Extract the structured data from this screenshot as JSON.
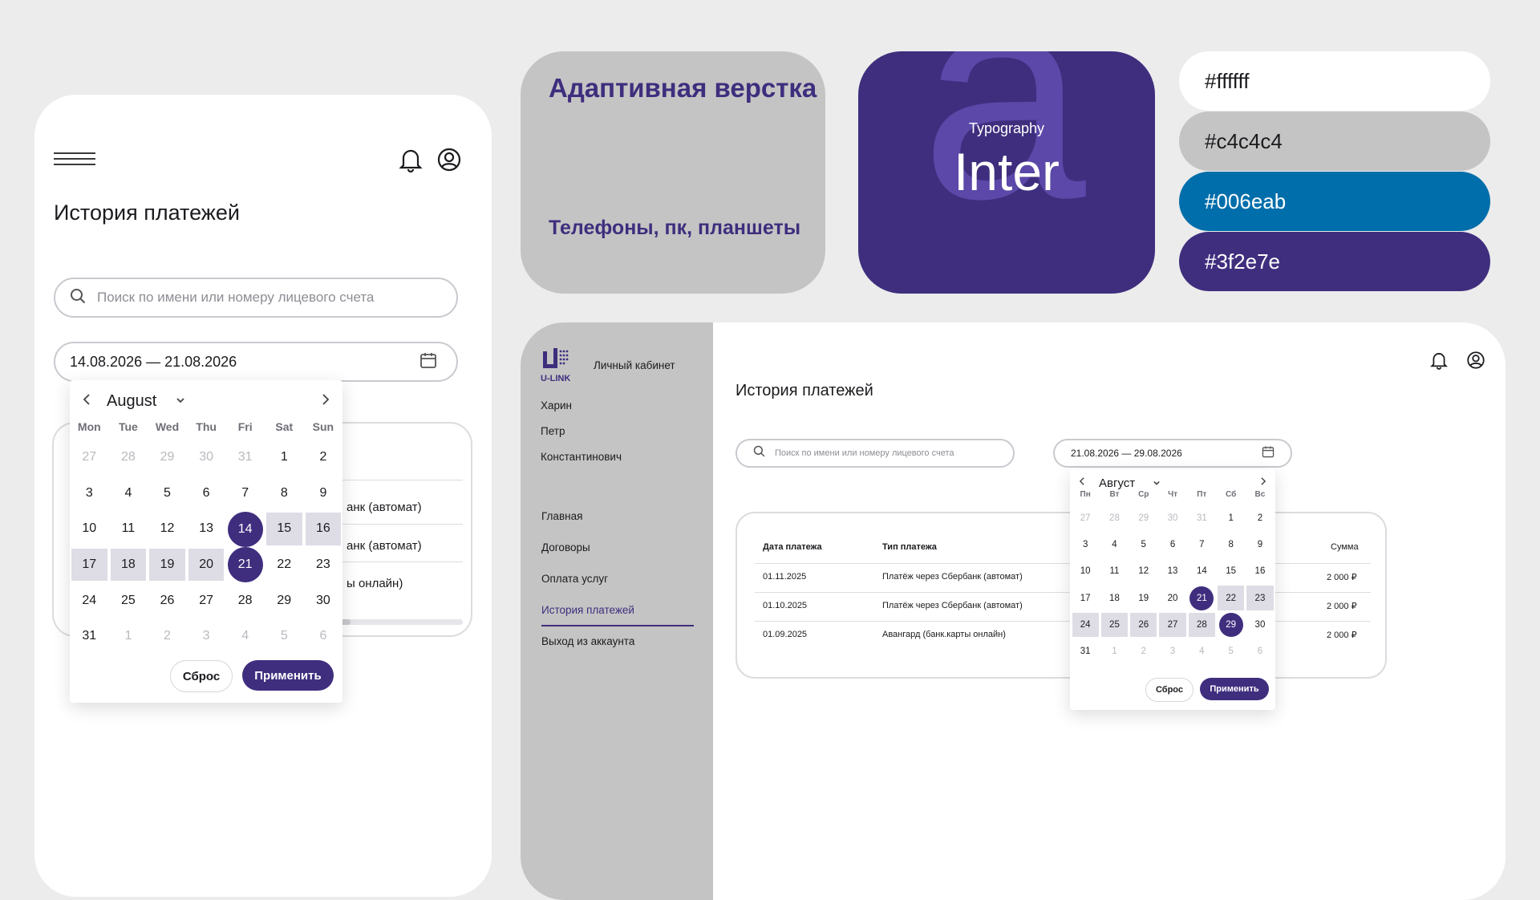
{
  "colors": {
    "background": "#ececec",
    "white": "#ffffff",
    "gray": "#c4c4c4",
    "blue": "#006eab",
    "purple": "#3f2e7e"
  },
  "mobile": {
    "title": "История платежей",
    "search_placeholder": "Поиск по имени или номеру лицевого счета",
    "date_range": "14.08.2026 — 21.08.2026",
    "row_fragments": [
      "анк (автомат)",
      "анк (автомат)",
      "ы онлайн)"
    ],
    "calendar": {
      "month": "August",
      "weekdays": [
        "Mon",
        "Tue",
        "Wed",
        "Thu",
        "Fri",
        "Sat",
        "Sun"
      ],
      "days": [
        [
          "27",
          "28",
          "29",
          "30",
          "31",
          "1",
          "2"
        ],
        [
          "3",
          "4",
          "5",
          "6",
          "7",
          "8",
          "9"
        ],
        [
          "10",
          "11",
          "12",
          "13",
          "14",
          "15",
          "16"
        ],
        [
          "17",
          "18",
          "19",
          "20",
          "21",
          "22",
          "23"
        ],
        [
          "24",
          "25",
          "26",
          "27",
          "28",
          "29",
          "30"
        ],
        [
          "31",
          "1",
          "2",
          "3",
          "4",
          "5",
          "6"
        ]
      ],
      "range_start": "14",
      "range_end": "21",
      "reset_label": "Сброс",
      "apply_label": "Применить"
    }
  },
  "adaptive_card": {
    "title": "Адаптивная верстка",
    "subtitle": "Телефоны, пк, планшеты"
  },
  "typography_card": {
    "label": "Typography",
    "font_name": "Inter",
    "glyph": "a"
  },
  "palette": [
    {
      "hex": "#ffffff",
      "text_color": "#1b1b1f"
    },
    {
      "hex": "#c4c4c4",
      "text_color": "#1b1b1f"
    },
    {
      "hex": "#006eab",
      "text_color": "#ffffff"
    },
    {
      "hex": "#3f2e7e",
      "text_color": "#ffffff"
    }
  ],
  "desktop": {
    "logo_text": "U-LINK",
    "cabinet_label": "Личный кабинет",
    "user_name": [
      "Харин",
      "Петр",
      "Константинович"
    ],
    "nav": [
      "Главная",
      "Договоры",
      "Оплата услуг",
      "История платежей",
      "Выход из аккаунта"
    ],
    "active_nav": "История платежей",
    "title": "История платежей",
    "search_placeholder": "Поиск по имени или номеру лицевого счета",
    "date_range": "21.08.2026 — 29.08.2026",
    "table": {
      "headers": [
        "Дата платежа",
        "Тип платежа",
        "Сумма"
      ],
      "rows": [
        [
          "01.11.2025",
          "Платёж через Сбербанк (автомат)",
          "2 000 ₽"
        ],
        [
          "01.10.2025",
          "Платёж через Сбербанк (автомат)",
          "2 000 ₽"
        ],
        [
          "01.09.2025",
          "Авангард (банк.карты онлайн)",
          "2 000 ₽"
        ]
      ]
    },
    "calendar": {
      "month": "Август",
      "weekdays": [
        "Пн",
        "Вт",
        "Ср",
        "Чт",
        "Пт",
        "Сб",
        "Вс"
      ],
      "days": [
        [
          "27",
          "28",
          "29",
          "30",
          "31",
          "1",
          "2"
        ],
        [
          "3",
          "4",
          "5",
          "6",
          "7",
          "8",
          "9"
        ],
        [
          "10",
          "11",
          "12",
          "13",
          "14",
          "15",
          "16"
        ],
        [
          "17",
          "18",
          "19",
          "20",
          "21",
          "22",
          "23"
        ],
        [
          "24",
          "25",
          "26",
          "27",
          "28",
          "29",
          "30"
        ],
        [
          "31",
          "1",
          "2",
          "3",
          "4",
          "5",
          "6"
        ]
      ],
      "range_start": "21",
      "range_end": "29",
      "reset_label": "Сброс",
      "apply_label": "Применить"
    }
  }
}
